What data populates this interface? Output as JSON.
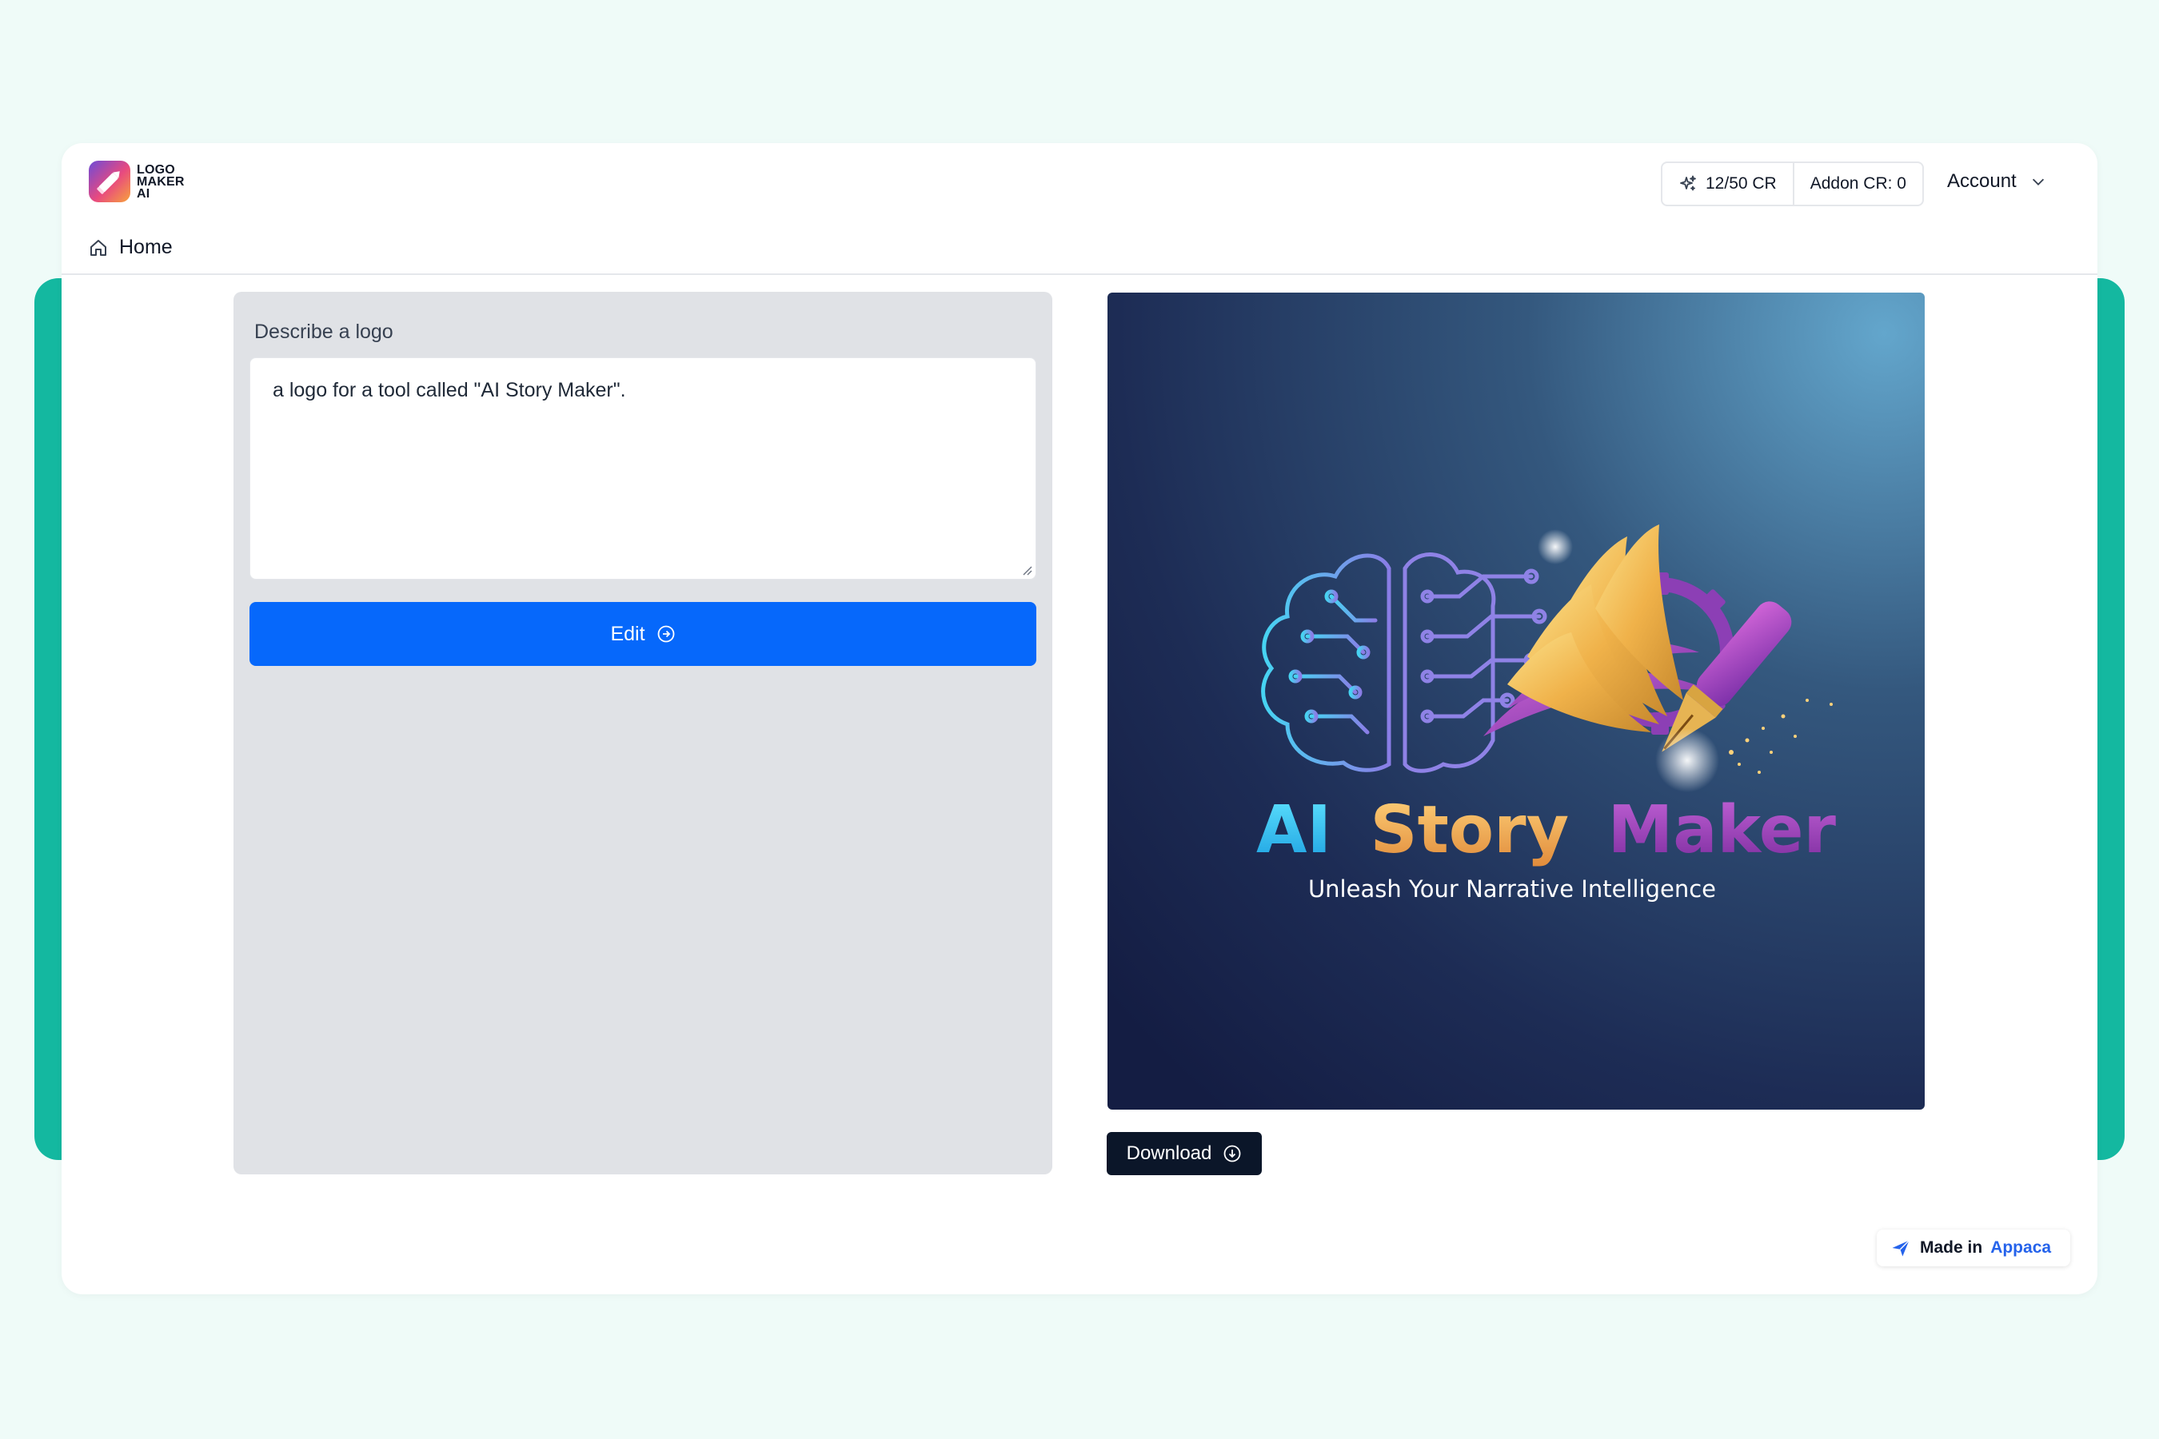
{
  "app": {
    "logo_lines": [
      "LOGO",
      "MAKER",
      "AI"
    ]
  },
  "header": {
    "credits": "12/50 CR",
    "addon_credits": "Addon CR: 0",
    "account_label": "Account",
    "home_label": "Home"
  },
  "form": {
    "label": "Describe a logo",
    "prompt_value": "a logo for a tool called \"AI Story Maker\".",
    "edit_label": "Edit"
  },
  "result": {
    "title_words": [
      "AI",
      "Story",
      "Maker"
    ],
    "tagline": "Unleash Your Narrative Intelligence",
    "download_label": "Download"
  },
  "footer": {
    "made_in_prefix": "Made in",
    "made_in_brand": "Appaca"
  },
  "colors": {
    "background": "#effbf8",
    "teal": "#14b8a0",
    "primary_button": "#0668fb",
    "download_button": "#0b1629",
    "panel": "#e0e2e6"
  },
  "icons": {
    "logo": "pencil-logo-icon",
    "credits": "sparkles-icon",
    "account": "chevron-down-icon",
    "home": "home-icon",
    "edit": "arrow-circle-right-icon",
    "download": "download-circle-icon",
    "made_in": "sparkle-icon"
  }
}
